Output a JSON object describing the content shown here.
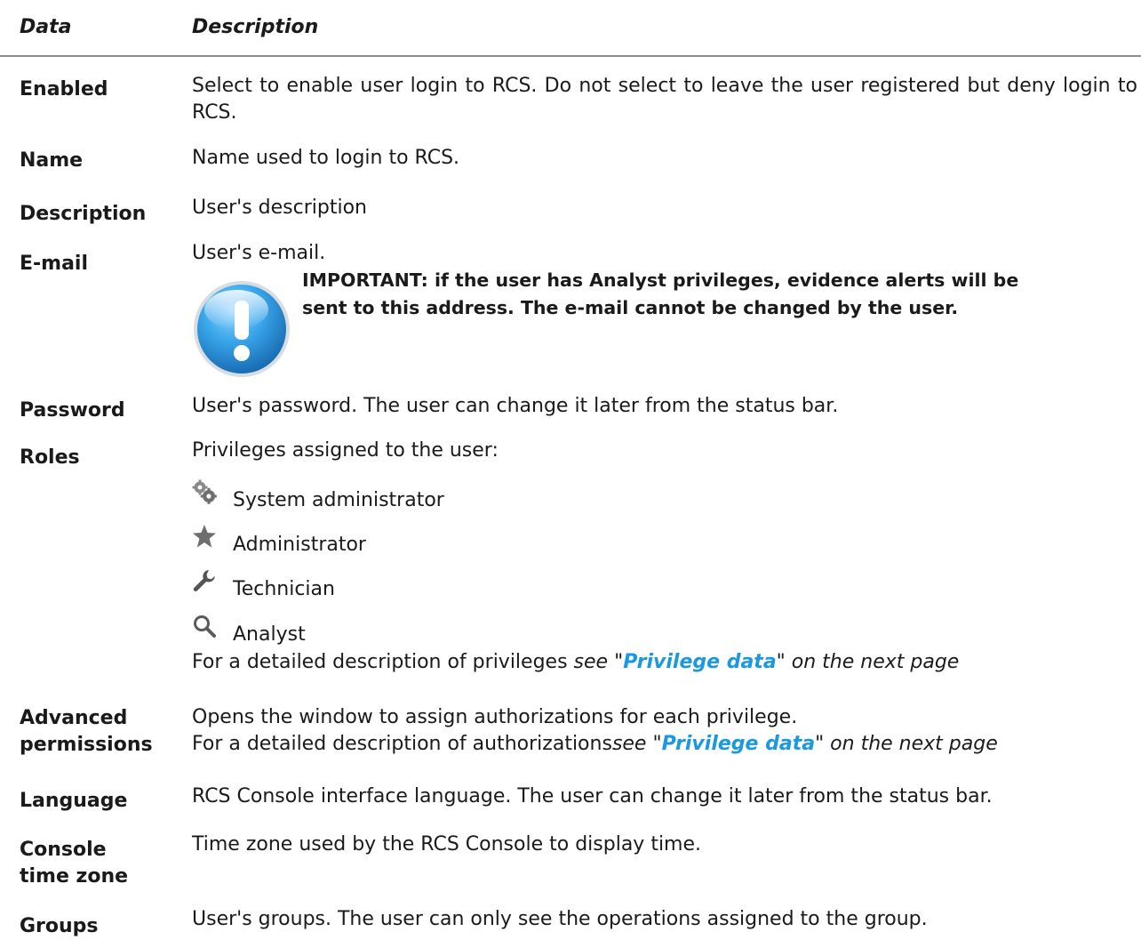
{
  "header": {
    "data": "Data",
    "description": "Description"
  },
  "rows": {
    "enabled": {
      "term": "Enabled",
      "desc": "Select to enable user login to RCS. Do not select to leave the user registered but deny login to RCS."
    },
    "name": {
      "term": "Name",
      "desc": "Name used to login to RCS."
    },
    "description": {
      "term": "Description",
      "desc": "User's description"
    },
    "email": {
      "term": "E-mail",
      "desc": "User's e-mail.",
      "important_line1": "IMPORTANT: if the user has Analyst privileges, evidence alerts will be",
      "important_line2": "sent to this address. The e-mail cannot be changed by the user."
    },
    "password": {
      "term": "Password",
      "desc": "User's password. The user can change it later from the status bar."
    },
    "roles": {
      "term": "Roles",
      "desc": "Privileges assigned to the user:",
      "items": [
        {
          "label": "System administrator",
          "icon": "gears-icon"
        },
        {
          "label": "Administrator",
          "icon": "star-icon"
        },
        {
          "label": "Technician",
          "icon": "wrench-icon"
        },
        {
          "label": "Analyst",
          "icon": "magnifier-icon"
        }
      ],
      "ref_prefix": "For a detailed description of privileges ",
      "ref_see": "see \"",
      "ref_link": "Privilege data",
      "ref_suffix": "\" on the next page"
    },
    "advanced": {
      "term_line1": "Advanced",
      "term_line2": "permissions",
      "desc": "Opens the window to assign authorizations for each privilege.",
      "ref_prefix": "For a detailed description of authorizations",
      "ref_see": "see \"",
      "ref_link": "Privilege data",
      "ref_suffix": "\" on the next page"
    },
    "language": {
      "term": "Language",
      "desc": "RCS Console interface language. The user can change it later from the status bar."
    },
    "timezone": {
      "term_line1": "Console",
      "term_line2": "time zone",
      "desc": "Time zone used by the RCS Console to display time."
    },
    "groups": {
      "term": "Groups",
      "desc": "User's groups. The user can only see the operations assigned to the group."
    }
  },
  "colors": {
    "link": "#1a99e0",
    "important_icon": "#2a8fd6",
    "rule": "#8c8c8c"
  }
}
